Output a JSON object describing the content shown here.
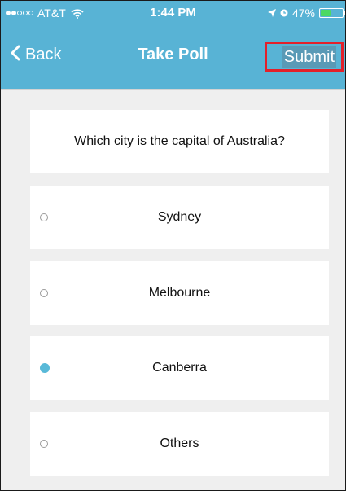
{
  "status_bar": {
    "carrier": "AT&T",
    "time": "1:44 PM",
    "battery": "47%",
    "signal_bars_filled": 2,
    "signal_bars_total": 5,
    "battery_level_fraction": 0.47
  },
  "nav": {
    "back_label": "Back",
    "title": "Take Poll",
    "submit_label": "Submit"
  },
  "poll": {
    "question": "Which city is the capital of Australia?",
    "options": [
      {
        "label": "Sydney",
        "selected": false
      },
      {
        "label": "Melbourne",
        "selected": false
      },
      {
        "label": "Canberra",
        "selected": true
      },
      {
        "label": "Others",
        "selected": false
      }
    ]
  },
  "colors": {
    "accent": "#58b3d5",
    "highlight_border": "#e3202a",
    "radio_selected": "#58b9d8",
    "background": "#efefef"
  }
}
